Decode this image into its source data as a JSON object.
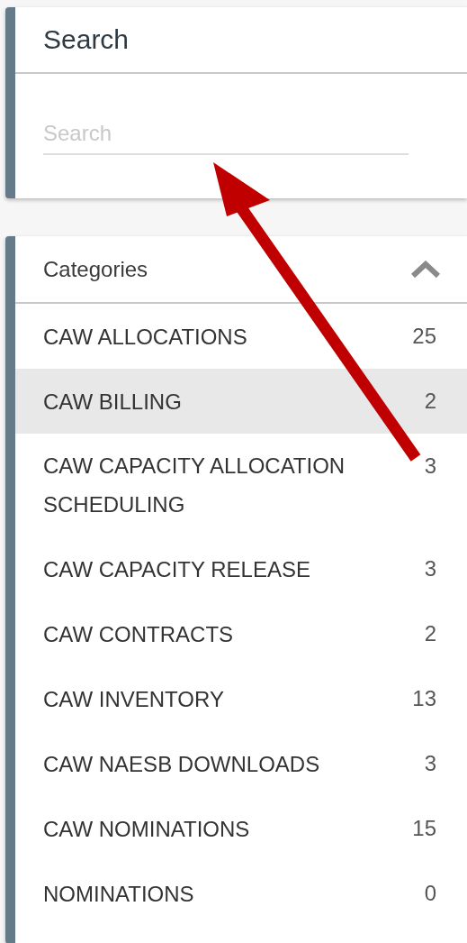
{
  "search_panel": {
    "title": "Search",
    "placeholder": "Search"
  },
  "categories": {
    "title": "Categories",
    "expanded": true,
    "items": [
      {
        "label": "CAW ALLOCATIONS",
        "count": "25",
        "selected": false
      },
      {
        "label": "CAW BILLING",
        "count": "2",
        "selected": true
      },
      {
        "label": "CAW CAPACITY ALLOCATION SCHEDULING",
        "count": "3",
        "selected": false
      },
      {
        "label": "CAW CAPACITY RELEASE",
        "count": "3",
        "selected": false
      },
      {
        "label": "CAW CONTRACTS",
        "count": "2",
        "selected": false
      },
      {
        "label": "CAW INVENTORY",
        "count": "13",
        "selected": false
      },
      {
        "label": "CAW NAESB DOWNLOADS",
        "count": "3",
        "selected": false
      },
      {
        "label": "CAW NOMINATIONS",
        "count": "15",
        "selected": false
      },
      {
        "label": "NOMINATIONS",
        "count": "0",
        "selected": false
      }
    ]
  }
}
